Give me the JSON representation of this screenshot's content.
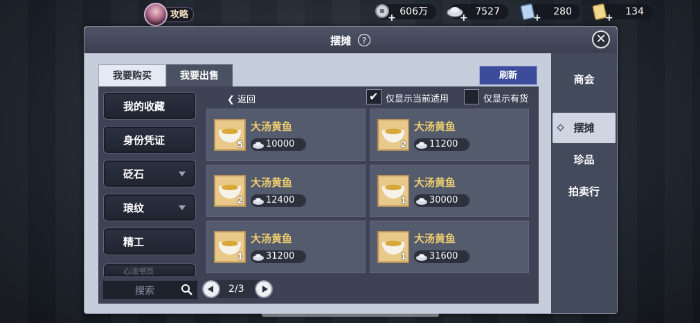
{
  "topbar": {
    "strategy_label": "攻略",
    "currencies": [
      {
        "icon": "silver-coin-icon",
        "value": "606万"
      },
      {
        "icon": "silver-ingot-icon",
        "value": "7527"
      },
      {
        "icon": "ticket-icon",
        "value": "280"
      },
      {
        "icon": "gold-ticket-icon",
        "value": "134"
      }
    ]
  },
  "panel": {
    "title": "摆摊",
    "help_glyph": "?",
    "close_glyph": "✕"
  },
  "tabs": {
    "buy": "我要购买",
    "sell": "我要出售"
  },
  "refresh_label": "刷新",
  "right_nav": {
    "items": [
      {
        "label": "商会",
        "active": false
      },
      {
        "label": "摆摊",
        "active": true
      },
      {
        "label": "珍品",
        "active": false
      },
      {
        "label": "拍卖行",
        "active": false
      }
    ]
  },
  "categories": [
    {
      "label": "我的收藏",
      "dropdown": false
    },
    {
      "label": "身份凭证",
      "dropdown": false
    },
    {
      "label": "砭石",
      "dropdown": true
    },
    {
      "label": "琅纹",
      "dropdown": true
    },
    {
      "label": "精工",
      "dropdown": false
    },
    {
      "label": "心法书页",
      "dropdown": false
    }
  ],
  "filters": {
    "back_label": "返回",
    "only_applicable": {
      "label": "仅显示当前适用",
      "checked": true
    },
    "only_in_stock": {
      "label": "仅显示有货",
      "checked": false
    }
  },
  "items": [
    {
      "name": "大汤黄鱼",
      "qty": "5",
      "price": "10000"
    },
    {
      "name": "大汤黄鱼",
      "qty": "2",
      "price": "11200"
    },
    {
      "name": "大汤黄鱼",
      "qty": "2",
      "price": "12400"
    },
    {
      "name": "大汤黄鱼",
      "qty": "1",
      "price": "30000"
    },
    {
      "name": "大汤黄鱼",
      "qty": "1",
      "price": "31200"
    },
    {
      "name": "大汤黄鱼",
      "qty": "1",
      "price": "31600"
    }
  ],
  "search": {
    "placeholder": "搜索"
  },
  "pagination": {
    "current": "2/3"
  },
  "colors": {
    "accent_gold": "#f0cf70",
    "refresh_blue": "#3c4c9a",
    "panel_bg": "#c7cedb"
  }
}
